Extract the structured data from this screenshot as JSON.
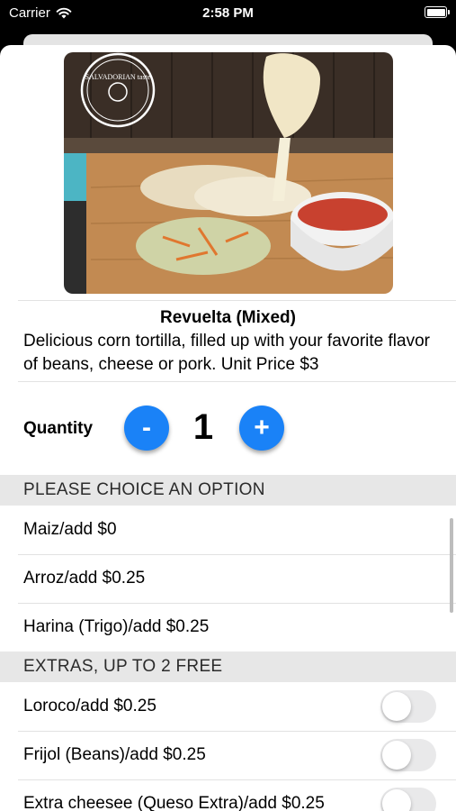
{
  "status_bar": {
    "carrier": "Carrier",
    "time": "2:58 PM"
  },
  "product": {
    "image_logo_text": "SALVADORIAN taste",
    "title": "Revuelta (Mixed)",
    "description": "Delicious corn tortilla, filled up with your favorite flavor of beans, cheese or pork. Unit Price $3"
  },
  "quantity": {
    "label": "Quantity",
    "value": "1",
    "minus_label": "-",
    "plus_label": "+"
  },
  "options_section": {
    "header": "PLEASE CHOICE AN OPTION",
    "items": [
      {
        "label": "Maiz/add $0"
      },
      {
        "label": "Arroz/add $0.25"
      },
      {
        "label": "Harina (Trigo)/add $0.25"
      }
    ]
  },
  "extras_section": {
    "header": "EXTRAS, UP TO 2 FREE",
    "items": [
      {
        "label": "Loroco/add $0.25",
        "on": false
      },
      {
        "label": "Frijol (Beans)/add $0.25",
        "on": false
      },
      {
        "label": "Extra cheesee (Queso Extra)/add $0.25",
        "on": false
      }
    ]
  },
  "colors": {
    "accent": "#1a82f7",
    "section_bg": "#e7e7e7",
    "toggle_off": "#e9e9ea"
  }
}
